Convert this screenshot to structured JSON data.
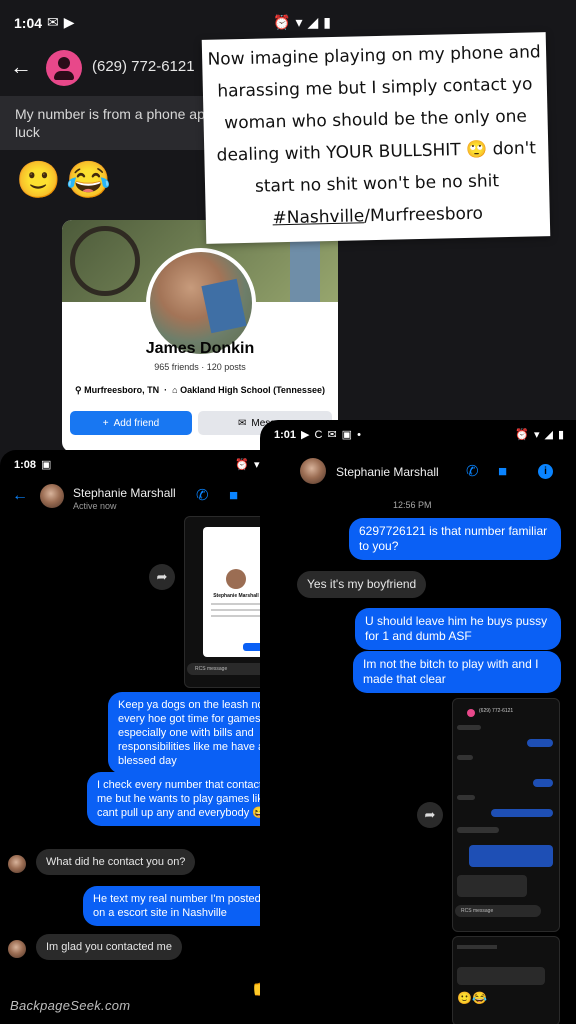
{
  "shot_a": {
    "status_time": "1:04",
    "contact_title": "(629) 772-6121",
    "incoming_message": "My number is from a phone app luck",
    "emojis": [
      "🙂",
      "😂"
    ],
    "caption": {
      "line1": "Now imagine playing on my phone and",
      "line2": "harassing me but I simply contact yo",
      "line3": "woman who should be the only one",
      "line4": "dealing with YOUR BULLSHIT 🙄 don't",
      "line5": "start no shit won't be no shit",
      "tag": "#Nashville",
      "tag_rest": "/Murfreesboro"
    },
    "profile": {
      "name": "James Donkin",
      "stats": "965 friends · 120 posts",
      "location": "Murfreesboro, TN",
      "school": "Oakland High School (Tennessee)",
      "add_friend": "Add friend",
      "message": "Message"
    }
  },
  "shot_b": {
    "status_time": "1:08",
    "contact_name": "Stephanie Marshall",
    "contact_status": "Active now",
    "mini_name": "Stephanie Marshall",
    "mini_compose": "RCS message",
    "messages": {
      "m1": "Keep ya dogs on the leash not every hoe got time for games especially one with bills and responsibilities like me have a blessed day",
      "m2": "I check every number that contact me but he wants to play games like I cant pull up any and everybody 😆",
      "m3": "What did he contact you on?",
      "m4": "He text my real number I'm posted on a escort site in Nashville",
      "m5": "Im glad you contacted me"
    },
    "thumbs": "👍"
  },
  "shot_c": {
    "status_time": "1:01",
    "status_extra": "C",
    "contact_name": "Stephanie Marshall",
    "timestamp": "12:56 PM",
    "messages": {
      "m1": "6297726121 is that number familiar to you?",
      "m2": "Yes it's my boyfriend",
      "m3": "U should leave him he buys pussy for 1 and dumb ASF",
      "m4": "Im not the bitch to play with and I made that clear"
    },
    "mini_title": "(629) 772-6121",
    "mini_compose": "RCS message"
  },
  "watermark": "BackpageSeek.com",
  "colors": {
    "messenger_blue": "#0a60f5",
    "accent_blue": "#0a84ff",
    "avatar_pink": "#e8488a",
    "facebook_blue": "#1877f2"
  }
}
